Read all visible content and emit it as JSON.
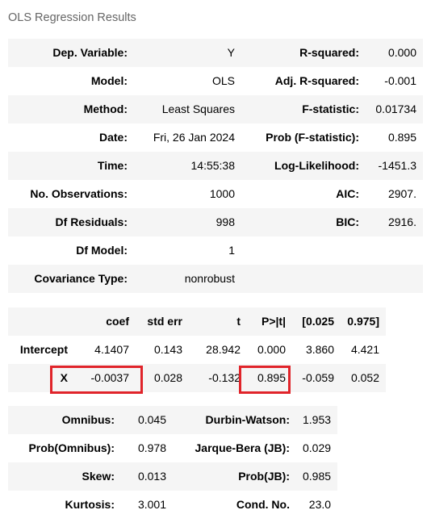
{
  "caption": "OLS Regression Results",
  "summary": [
    [
      "Dep. Variable:",
      "Y",
      "R-squared:",
      "0.000"
    ],
    [
      "Model:",
      "OLS",
      "Adj. R-squared:",
      "-0.001"
    ],
    [
      "Method:",
      "Least Squares",
      "F-statistic:",
      "0.01734"
    ],
    [
      "Date:",
      "Fri, 26 Jan 2024",
      "Prob (F-statistic):",
      "0.895"
    ],
    [
      "Time:",
      "14:55:38",
      "Log-Likelihood:",
      "-1451.3"
    ],
    [
      "No. Observations:",
      "1000",
      "AIC:",
      "2907."
    ],
    [
      "Df Residuals:",
      "998",
      "BIC:",
      "2916."
    ],
    [
      "Df Model:",
      "1",
      "",
      ""
    ],
    [
      "Covariance Type:",
      "nonrobust",
      "",
      ""
    ]
  ],
  "coef": {
    "headers": [
      "",
      "coef",
      "std err",
      "t",
      "P>|t|",
      "[0.025",
      "0.975]"
    ],
    "rows": [
      [
        "Intercept",
        "4.1407",
        "0.143",
        "28.942",
        "0.000",
        "3.860",
        "4.421"
      ],
      [
        "X",
        "-0.0037",
        "0.028",
        "-0.132",
        "0.895",
        "-0.059",
        "0.052"
      ]
    ]
  },
  "diagnostics": [
    [
      "Omnibus:",
      "0.045",
      "Durbin-Watson:",
      "1.953"
    ],
    [
      "Prob(Omnibus):",
      "0.978",
      "Jarque-Bera (JB):",
      "0.029"
    ],
    [
      "Skew:",
      "0.013",
      "Prob(JB):",
      "0.985"
    ],
    [
      "Kurtosis:",
      "3.001",
      "Cond. No.",
      "23.0"
    ]
  ],
  "highlight_color": "#e0242a"
}
